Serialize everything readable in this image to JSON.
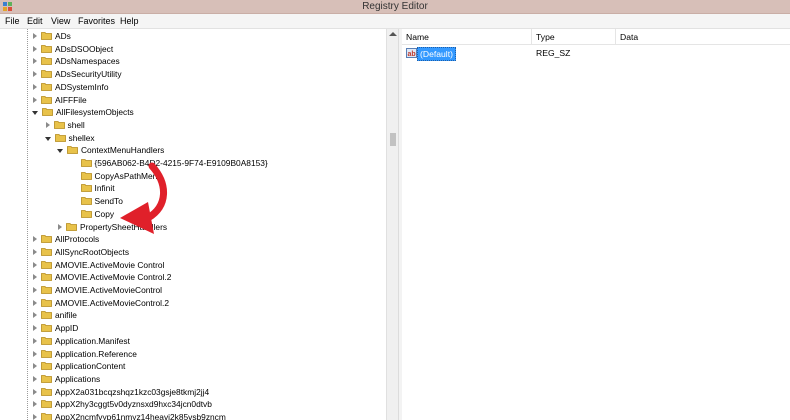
{
  "window": {
    "title": "Registry Editor"
  },
  "menu": [
    "File",
    "Edit",
    "View",
    "Favorites",
    "Help"
  ],
  "tree": {
    "items": [
      {
        "label": "ADs",
        "level": 1,
        "state": "collapsed"
      },
      {
        "label": "ADsDSOObject",
        "level": 1,
        "state": "collapsed"
      },
      {
        "label": "ADsNamespaces",
        "level": 1,
        "state": "collapsed"
      },
      {
        "label": "ADsSecurityUtility",
        "level": 1,
        "state": "collapsed"
      },
      {
        "label": "ADSystemInfo",
        "level": 1,
        "state": "collapsed"
      },
      {
        "label": "AIFFFile",
        "level": 1,
        "state": "collapsed"
      },
      {
        "label": "AllFilesystemObjects",
        "level": 1,
        "state": "expanded"
      },
      {
        "label": "shell",
        "level": 2,
        "state": "collapsed"
      },
      {
        "label": "shellex",
        "level": 2,
        "state": "expanded"
      },
      {
        "label": "ContextMenuHandlers",
        "level": 3,
        "state": "expanded"
      },
      {
        "label": "{596AB062-B4D2-4215-9F74-E9109B0A8153}",
        "level": 4,
        "state": "none"
      },
      {
        "label": "CopyAsPathMenu",
        "level": 4,
        "state": "none"
      },
      {
        "label": "Infinit",
        "level": 4,
        "state": "none"
      },
      {
        "label": "SendTo",
        "level": 4,
        "state": "none"
      },
      {
        "label": "Copy",
        "level": 4,
        "state": "none"
      },
      {
        "label": "PropertySheetHandlers",
        "level": 3,
        "state": "collapsed"
      },
      {
        "label": "AllProtocols",
        "level": 1,
        "state": "collapsed"
      },
      {
        "label": "AllSyncRootObjects",
        "level": 1,
        "state": "collapsed"
      },
      {
        "label": "AMOVIE.ActiveMovie Control",
        "level": 1,
        "state": "collapsed"
      },
      {
        "label": "AMOVIE.ActiveMovie Control.2",
        "level": 1,
        "state": "collapsed"
      },
      {
        "label": "AMOVIE.ActiveMovieControl",
        "level": 1,
        "state": "collapsed"
      },
      {
        "label": "AMOVIE.ActiveMovieControl.2",
        "level": 1,
        "state": "collapsed"
      },
      {
        "label": "anifile",
        "level": 1,
        "state": "collapsed"
      },
      {
        "label": "AppID",
        "level": 1,
        "state": "collapsed"
      },
      {
        "label": "Application.Manifest",
        "level": 1,
        "state": "collapsed"
      },
      {
        "label": "Application.Reference",
        "level": 1,
        "state": "collapsed"
      },
      {
        "label": "ApplicationContent",
        "level": 1,
        "state": "collapsed"
      },
      {
        "label": "Applications",
        "level": 1,
        "state": "collapsed"
      },
      {
        "label": "AppX2a031bcqzshqz1kzc03gsje8tkmj2jj4",
        "level": 1,
        "state": "collapsed"
      },
      {
        "label": "AppX2hy3cggt5v0dyznsxd9hxc34jcn0dtvb",
        "level": 1,
        "state": "collapsed"
      },
      {
        "label": "AppX2ncmfvyp61nmyz14heavj2k85vsb9zncm",
        "level": 1,
        "state": "collapsed"
      }
    ]
  },
  "list": {
    "columns": {
      "name": "Name",
      "type": "Type",
      "data": "Data"
    },
    "rows": [
      {
        "name": "(Default)",
        "type": "REG_SZ",
        "data": ""
      }
    ]
  },
  "colors": {
    "titlebar": "#d7bfb8",
    "selection": "#3399ff",
    "folder": "#e8c24a",
    "arrow": "#e0202a"
  },
  "icons": {
    "app": "registry-editor-icon",
    "folder": "folder-icon",
    "value": "string-value-icon",
    "annotation": "red-curved-arrow-icon"
  }
}
